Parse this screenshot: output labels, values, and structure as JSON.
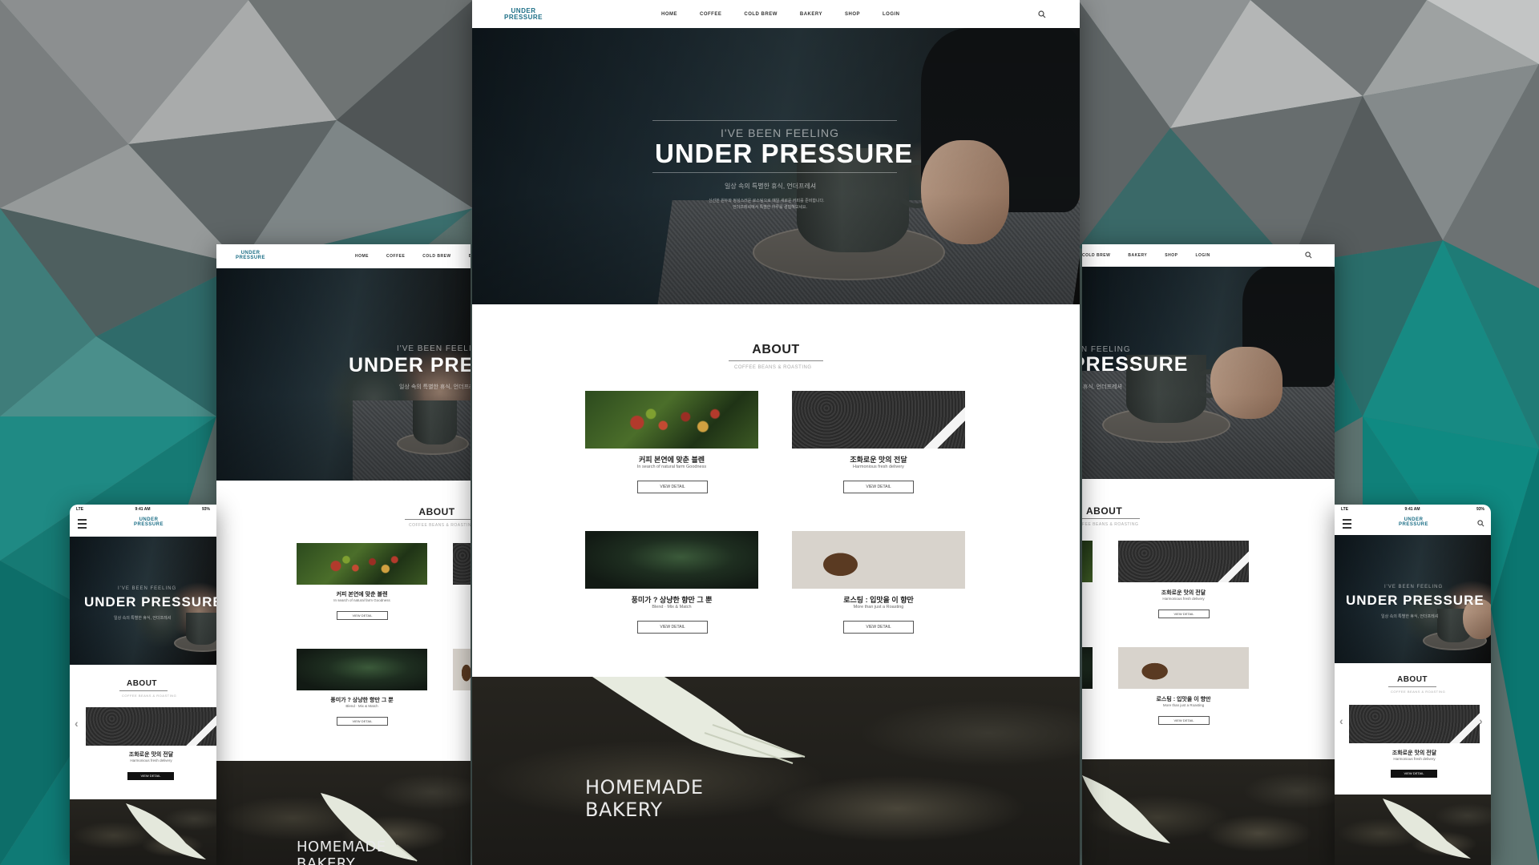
{
  "site": {
    "logo_line1": "UNDER",
    "logo_line2": "PRESSURE",
    "nav": [
      "HOME",
      "COFFEE",
      "COLD BREW",
      "BAKERY",
      "SHOP",
      "LOGIN"
    ],
    "hero": {
      "subtitle": "I'VE BEEN FEELING",
      "title": "UNDER PRESSURE",
      "tagline": "일상 속의 특별한 휴식, 언더프레셔",
      "body_line1": "신선한 원두와 정성스러운 로스팅으로 매일 새로운 커피를 준비합니다.",
      "body_line2": "언더프레셔에서 특별한 하루를 경험해보세요."
    },
    "about": {
      "title": "ABOUT",
      "subtitle": "COFFEE BEANS & ROASTING",
      "cards": [
        {
          "title": "커피 본연에 맞춘 블렌",
          "desc": "In search of natural farm Goodness",
          "button": "VIEW DETAIL"
        },
        {
          "title": "조화로운 맛의 전달",
          "desc": "Harmonious fresh delivery",
          "button": "VIEW DETAIL"
        },
        {
          "title": "풍미가 ? 상냥한 향만 그 뿐",
          "desc": "Blend · Mix & Match",
          "button": "VIEW DETAIL"
        },
        {
          "title": "로스팅 : 입맛을 이 향만",
          "desc": "More than just a Roasting",
          "button": "VIEW DETAIL"
        }
      ]
    },
    "bakery": {
      "line1": "HOMEMADE",
      "line2": "BAKERY"
    },
    "mobile": {
      "status_left": "LTE",
      "status_time": "9:41 AM",
      "status_right": "93%",
      "prev_icon": "‹",
      "next_icon": "›"
    }
  }
}
